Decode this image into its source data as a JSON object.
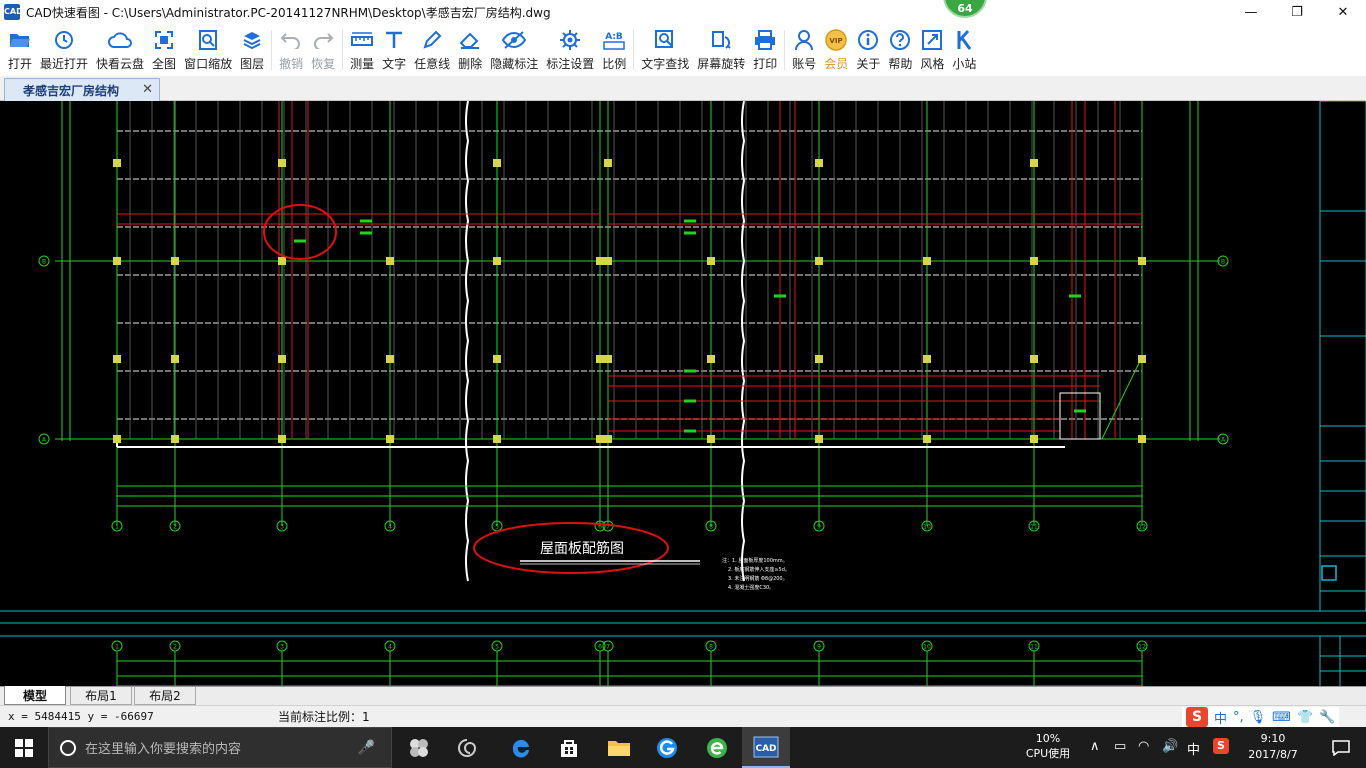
{
  "window": {
    "title": "CAD快速看图 - C:\\Users\\Administrator.PC-20141127NRHM\\Desktop\\孝感吉宏厂房结构.dwg",
    "badge": "64",
    "minimize": "—",
    "restore": "❐",
    "close": "✕"
  },
  "toolbar": {
    "open": "打开",
    "recent": "最近打开",
    "cloud": "快看云盘",
    "fullview": "全图",
    "window_zoom": "窗口缩放",
    "layers": "图层",
    "undo": "撤销",
    "redo": "恢复",
    "measure": "测量",
    "text": "文字",
    "freeline": "任意线",
    "delete": "删除",
    "hide_marks": "隐藏标注",
    "mark_settings": "标注设置",
    "ratio": "比例",
    "ratio_icon": "A:B",
    "text_find": "文字查找",
    "rotate_screen": "屏幕旋转",
    "print": "打印",
    "account": "账号",
    "vip": "会员",
    "vip_icon": "VIP",
    "about": "关于",
    "help": "帮助",
    "style": "风格",
    "site": "小站",
    "accent": "#1e6fd9",
    "vip_color": "#d39a1c"
  },
  "tab": {
    "name": "孝感吉宏厂房结构",
    "close": "✕"
  },
  "drawing": {
    "axis_letters": [
      "A",
      "B"
    ],
    "axis_numbers": [
      "1",
      "2",
      "3",
      "4",
      "5",
      "6",
      "7",
      "8",
      "9",
      "10",
      "11",
      "12"
    ],
    "plan_title": "屋面板配筋图",
    "notes": [
      "注：1. 屋面板厚度100mm。",
      "2. 板底钢筋伸入支座≥5d。",
      "3. 未注明钢筋 Φ8@200。",
      "4. 混凝土强度C30。"
    ]
  },
  "layout_tabs": [
    "模型",
    "布局1",
    "布局2"
  ],
  "status": {
    "coords": "x = 5484415  y = -66697",
    "scale": "当前标注比例：1"
  },
  "ime": {
    "logo": "S",
    "lang": "中",
    "punct": "°,"
  },
  "taskbar": {
    "search_placeholder": "在这里输入你要搜索的内容",
    "cpu_pct": "10%",
    "cpu_label": "CPU使用",
    "ime_lang": "中",
    "time": "9:10",
    "date": "2017/8/7",
    "cad_app": "CAD"
  }
}
